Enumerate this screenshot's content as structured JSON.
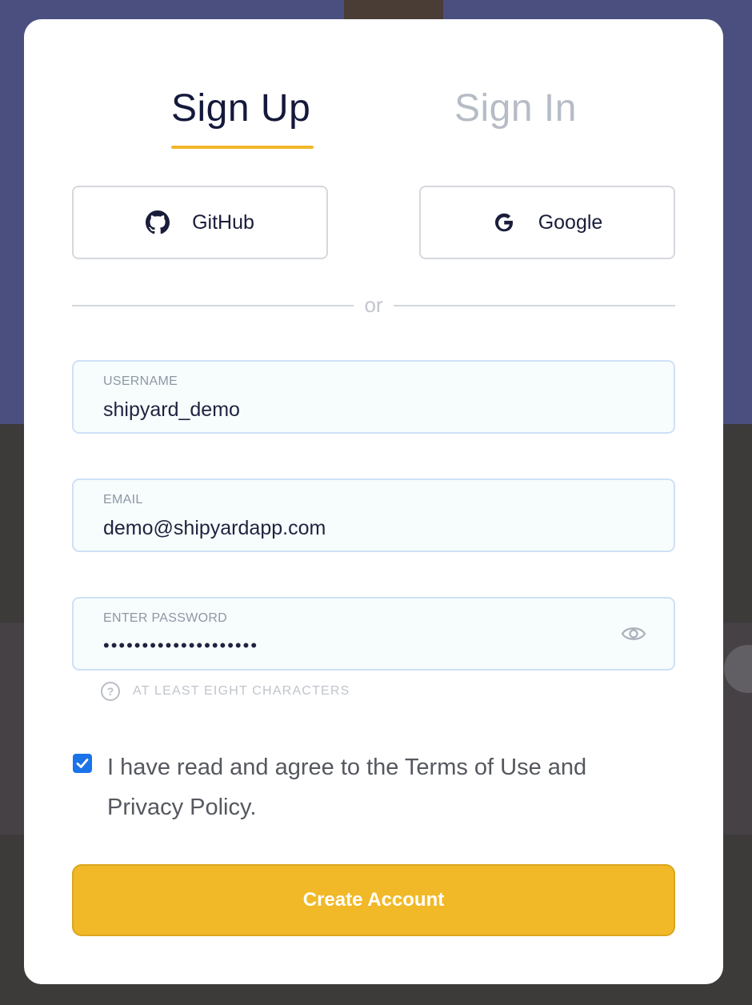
{
  "tabs": [
    {
      "label": "Sign Up",
      "active": true
    },
    {
      "label": "Sign In",
      "active": false
    }
  ],
  "oauth": {
    "github_label": "GitHub",
    "google_label": "Google",
    "github_icon": "github-icon",
    "google_icon": "google-icon"
  },
  "divider": {
    "text": "or"
  },
  "fields": {
    "username": {
      "label": "USERNAME",
      "value": "shipyard_demo"
    },
    "email": {
      "label": "EMAIL",
      "value": "demo@shipyardapp.com"
    },
    "password": {
      "label": "ENTER PASSWORD",
      "value": "••••••••••••••••••••",
      "toggle_icon": "eye-icon"
    }
  },
  "hint": {
    "icon": "question-icon",
    "text": "AT LEAST EIGHT CHARACTERS"
  },
  "agreement": {
    "checked": true,
    "text": "I have read and agree to the Terms of Use and Privacy Policy."
  },
  "submit": {
    "label": "Create Account"
  },
  "colors": {
    "accent": "#f1b928",
    "title_active": "#14193c",
    "title_inactive": "#b6bcc6",
    "checkbox": "#1a73e8",
    "overlay_top": "#4b4f80"
  }
}
